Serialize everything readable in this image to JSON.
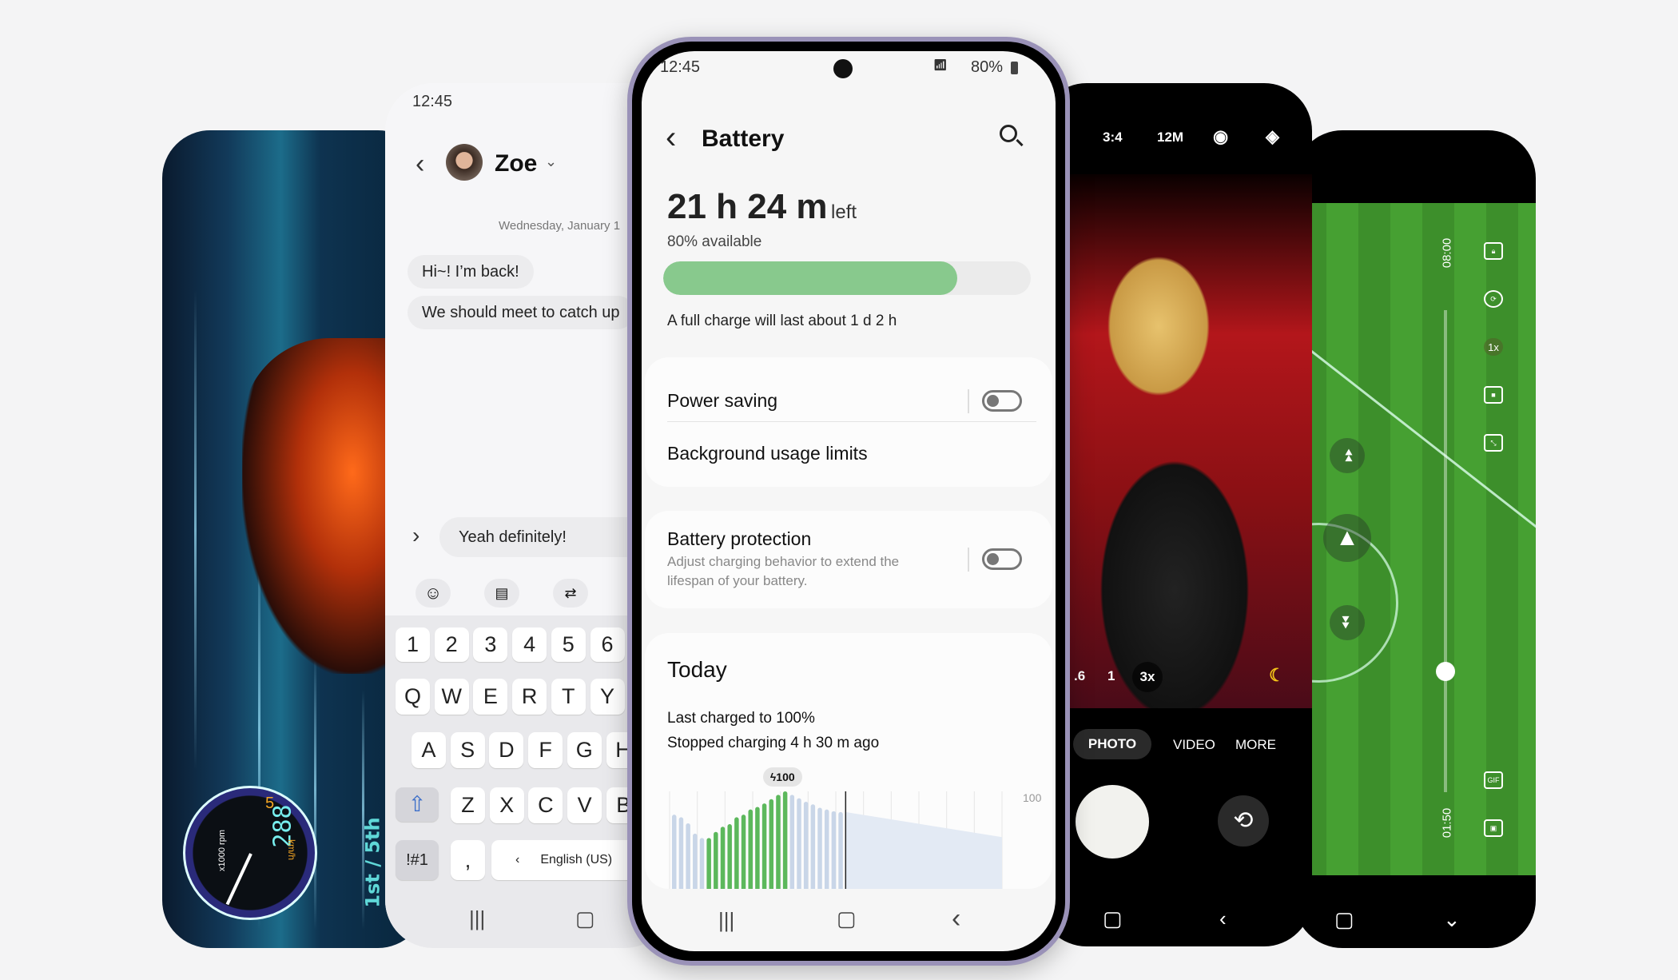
{
  "game": {
    "gauge_speed": "288",
    "gauge_gear": "5",
    "gauge_unit": "km/h",
    "gauge_rpm": "x1000 rpm",
    "gear_label": "1st / 5th"
  },
  "messages": {
    "time": "12:45",
    "contact": "Zoe",
    "date": "Wednesday, January 1",
    "bubbles": [
      "Hi~! I’m back!",
      "We should meet to catch up"
    ],
    "input": "Yeah definitely!",
    "rows": {
      "numbers": [
        "1",
        "2",
        "3",
        "4",
        "5",
        "6"
      ],
      "top": [
        "Q",
        "W",
        "E",
        "R",
        "T",
        "Y"
      ],
      "middle": [
        "A",
        "S",
        "D",
        "F",
        "G",
        "H"
      ],
      "bottom": [
        "Z",
        "X",
        "C",
        "V",
        "B"
      ]
    },
    "symbols_key": "!#1",
    "comma_key": ",",
    "language": "English (US)"
  },
  "battery": {
    "time": "12:45",
    "status_battery": "80%",
    "title": "Battery",
    "remaining": "21 h 24 m",
    "remaining_suffix": "left",
    "available": "80% available",
    "level_percent": 80,
    "full_charge": "A full charge will last about 1 d 2 h",
    "power_saving": {
      "label": "Power saving",
      "on": false
    },
    "background_limits": "Background usage limits",
    "protection": {
      "label": "Battery protection",
      "desc_1": "Adjust charging behavior to extend the",
      "desc_2": "lifespan of your battery.",
      "on": false
    },
    "today": {
      "title": "Today",
      "last_charged": "Last charged to 100%",
      "stopped": "Stopped charging 4 h 30 m ago"
    },
    "colors": {
      "fill": "#88c98d",
      "charging": "#5cb85c",
      "usage": "#c9d6e8",
      "projection": "#e3eaf4"
    }
  },
  "chart_data": {
    "type": "bar",
    "y_label_max": "100",
    "peak_badge": "100",
    "ylim": [
      0,
      100
    ],
    "values": [
      73,
      70,
      63,
      51,
      46,
      46,
      53,
      59,
      62,
      70,
      73,
      79,
      82,
      86,
      91,
      96,
      100,
      96,
      92,
      88,
      85,
      81,
      79,
      77,
      76
    ],
    "charging": [
      false,
      false,
      false,
      false,
      false,
      true,
      true,
      true,
      true,
      true,
      true,
      true,
      true,
      true,
      true,
      true,
      true,
      false,
      false,
      false,
      false,
      false,
      false,
      false,
      false
    ],
    "projection": [
      76,
      47
    ]
  },
  "camera": {
    "ratio": "3:4",
    "resolution": "12M",
    "zooms": [
      ".6",
      "1",
      "3x"
    ],
    "modes": [
      "PHOTO",
      "VIDEO",
      "MORE"
    ],
    "active_mode": "PHOTO"
  },
  "sport": {
    "time_end": "08:00",
    "time_start": "01:50",
    "zoom": "1x",
    "gif": "GIF",
    "position_percent": 25
  }
}
